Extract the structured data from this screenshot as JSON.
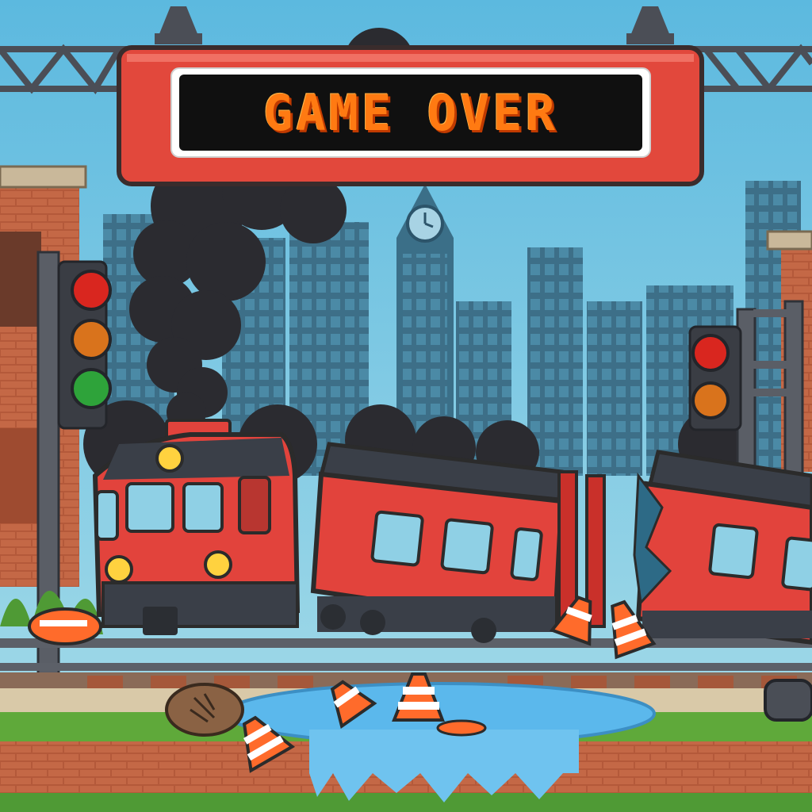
{
  "screen": {
    "title": "GAME OVER"
  },
  "colors": {
    "sky": "#6ec3e0",
    "sign_frame": "#e2483c",
    "sign_screen": "#101010",
    "title_text": "#ff7a12",
    "train_red": "#e2433c",
    "train_roof": "#3a3f48",
    "smoke": "#2b2b30",
    "water": "#5bb8ec",
    "grass": "#5fa93a",
    "brick": "#b4593a"
  },
  "icons": {
    "signal_lights": [
      "red-light-icon",
      "amber-light-icon",
      "green-light-icon"
    ],
    "hazards": "traffic-cone-icon"
  }
}
